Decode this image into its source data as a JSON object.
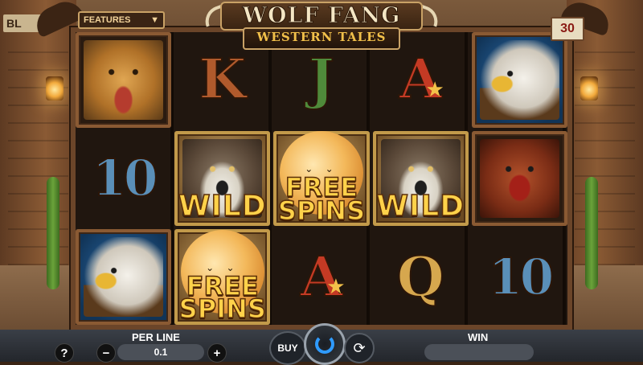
{
  "game": {
    "logo_title": "WOLF FANG",
    "logo_subtitle": "WESTERN TALES",
    "features_label": "FEATURES",
    "features_arrow": "▼",
    "lines": "30",
    "sign_text": "BL"
  },
  "reels": [
    [
      {
        "symbol": "leopard",
        "text": ""
      },
      {
        "symbol": "ten",
        "text": "10"
      },
      {
        "symbol": "eagle",
        "text": ""
      }
    ],
    [
      {
        "symbol": "K",
        "text": "K"
      },
      {
        "symbol": "wolf-wild",
        "text": "WILD"
      },
      {
        "symbol": "free-spins",
        "text": [
          "FREE",
          "SPINS"
        ]
      }
    ],
    [
      {
        "symbol": "J",
        "text": "J"
      },
      {
        "symbol": "free-spins",
        "text": [
          "FREE",
          "SPINS"
        ]
      },
      {
        "symbol": "A",
        "text": "A"
      }
    ],
    [
      {
        "symbol": "A",
        "text": "A"
      },
      {
        "symbol": "wolf-wild",
        "text": "WILD"
      },
      {
        "symbol": "Q",
        "text": "Q"
      }
    ],
    [
      {
        "symbol": "eagle",
        "text": ""
      },
      {
        "symbol": "bear",
        "text": ""
      },
      {
        "symbol": "ten",
        "text": "10"
      }
    ]
  ],
  "controls": {
    "help": "?",
    "per_line_label": "PER LINE",
    "per_line_value": "0.1",
    "minus": "−",
    "plus": "+",
    "buy": "BUY",
    "autoplay_icon": "⟳",
    "win_label": "WIN",
    "win_value": ""
  },
  "colors": {
    "spin_accent": "#2f9bff",
    "gold_text": "#ffd24a"
  }
}
